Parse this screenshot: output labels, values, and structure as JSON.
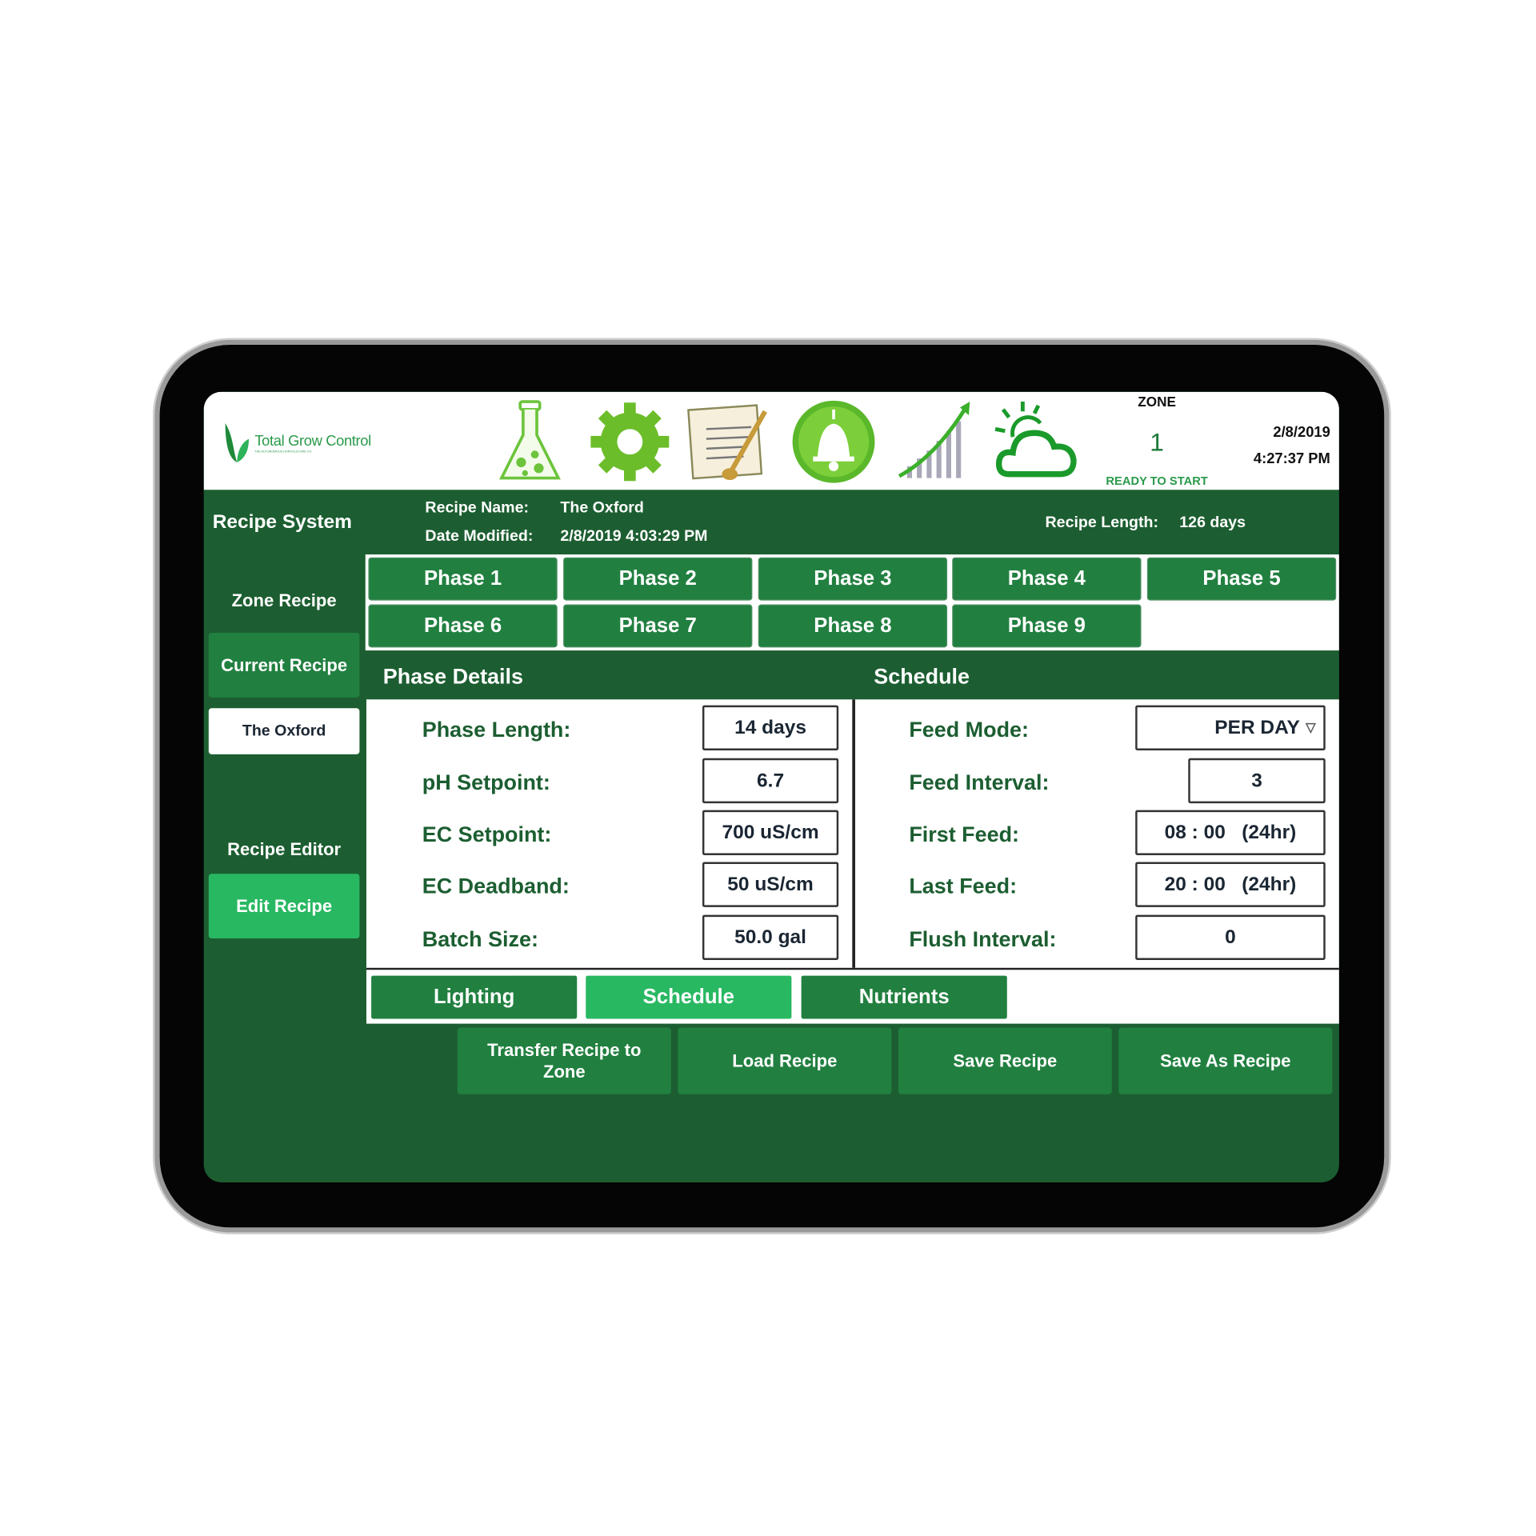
{
  "app": {
    "logo_text": "Total Grow Control",
    "logo_tagline": "THE AUTONOMOUS HORTICULTURE CO."
  },
  "toolbar": {
    "icons": [
      "flask-icon",
      "gear-icon",
      "recipe-icon",
      "bell-icon",
      "chart-growth-icon",
      "weather-icon"
    ]
  },
  "zone": {
    "label": "ZONE",
    "number": "1",
    "status": "READY TO START"
  },
  "clock": {
    "date": "2/8/2019",
    "time": "4:27:37 PM"
  },
  "sidebar": {
    "title": "Recipe System",
    "zone_recipe_label": "Zone Recipe",
    "current_recipe": "Current Recipe",
    "current_recipe_name": "The Oxford",
    "recipe_editor_label": "Recipe Editor",
    "edit_recipe": "Edit Recipe"
  },
  "recipe": {
    "name_label": "Recipe Name:",
    "name": "The Oxford",
    "modified_label": "Date Modified:",
    "modified": "2/8/2019 4:03:29 PM",
    "length_label": "Recipe Length:",
    "length": "126 days"
  },
  "phases": [
    "Phase 1",
    "Phase 2",
    "Phase 3",
    "Phase 4",
    "Phase 5",
    "Phase 6",
    "Phase 7",
    "Phase 8",
    "Phase 9"
  ],
  "phase_details": {
    "title": "Phase Details",
    "rows": [
      {
        "label": "Phase Length:",
        "value": "14 days"
      },
      {
        "label": "pH Setpoint:",
        "value": "6.7"
      },
      {
        "label": "EC Setpoint:",
        "value": "700 uS/cm"
      },
      {
        "label": "EC Deadband:",
        "value": "50 uS/cm"
      },
      {
        "label": "Batch Size:",
        "value": "50.0 gal"
      }
    ]
  },
  "schedule": {
    "title": "Schedule",
    "feed_mode_label": "Feed Mode:",
    "feed_mode": "PER DAY",
    "feed_interval_label": "Feed Interval:",
    "feed_interval": "3",
    "first_feed_label": "First Feed:",
    "first_feed": "08 : 00   (24hr)",
    "last_feed_label": "Last Feed:",
    "last_feed": "20 : 00   (24hr)",
    "flush_interval_label": "Flush Interval:",
    "flush_interval": "0"
  },
  "tabs": [
    {
      "label": "Lighting",
      "active": false
    },
    {
      "label": "Schedule",
      "active": true
    },
    {
      "label": "Nutrients",
      "active": false
    }
  ],
  "actions": {
    "transfer": "Transfer Recipe to Zone",
    "load": "Load Recipe",
    "save": "Save Recipe",
    "save_as": "Save As Recipe"
  },
  "colors": {
    "dark_green": "#1c5e31",
    "button_green": "#218040",
    "active_green": "#29b862"
  }
}
